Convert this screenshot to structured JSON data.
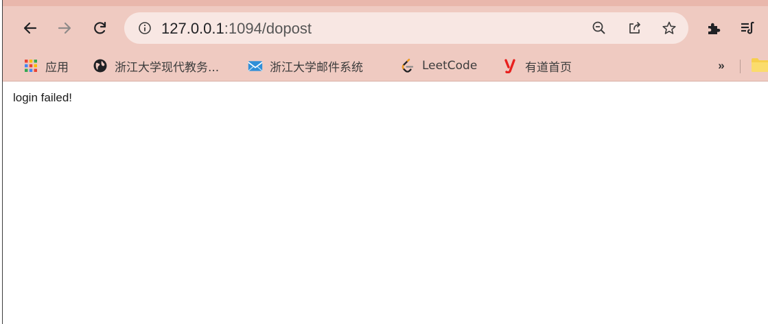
{
  "browser": {
    "url_host": "127.0.0.1",
    "url_path": ":1094/dopost",
    "icons": {
      "back": "arrow-left-icon",
      "forward": "arrow-right-icon",
      "reload": "reload-icon",
      "site_info": "info-icon",
      "zoom": "zoom-out-icon",
      "share": "share-icon",
      "bookmark": "star-icon",
      "extensions": "puzzle-icon",
      "reading_list": "reading-list-icon"
    },
    "theme_colors": {
      "toolbar": "#efcac1",
      "omnibox": "#f8e7e3"
    }
  },
  "bookmarks": {
    "items": [
      {
        "label": "应用",
        "icon": "apps-grid-icon"
      },
      {
        "label": "浙江大学现代教务...",
        "icon": "globe-icon"
      },
      {
        "label": "浙江大学邮件系统",
        "icon": "mail-icon"
      },
      {
        "label": "LeetCode",
        "icon": "leetcode-icon"
      },
      {
        "label": "有道首页",
        "icon": "youdao-icon"
      }
    ],
    "overflow_label": "»"
  },
  "page": {
    "message": "login failed!"
  }
}
